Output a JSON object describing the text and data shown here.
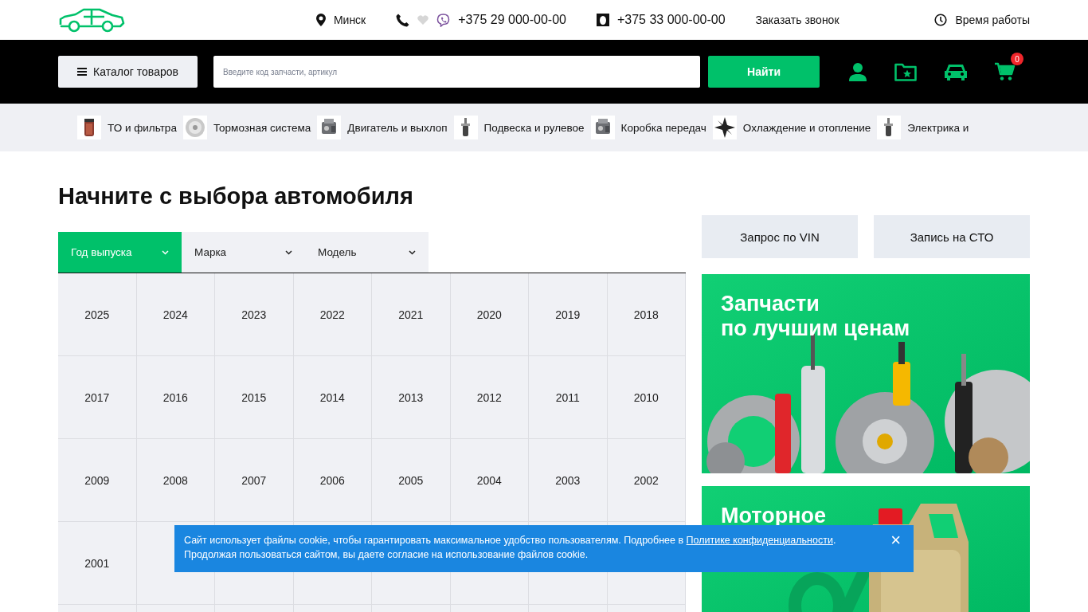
{
  "header": {
    "city": "Минск",
    "phones": [
      {
        "kind": "mobile",
        "number": "+375 29 000-00-00"
      },
      {
        "kind": "life",
        "number": "+375 33 000-00-00"
      }
    ],
    "callback": "Заказать звонок",
    "hours": "Время работы"
  },
  "navbar": {
    "catalog_button": "Каталог товаров",
    "search": {
      "placeholder": "Введите код запчасти, артикул"
    },
    "search_button": "Найти",
    "cart_count": "0"
  },
  "categories": [
    {
      "label": "ТО и фильтра",
      "kind": "filter"
    },
    {
      "label": "Тормозная система",
      "kind": "disc"
    },
    {
      "label": "Двигатель и выхлоп",
      "kind": "engine"
    },
    {
      "label": "Подвеска и рулевое",
      "kind": "shock"
    },
    {
      "label": "Коробка передач",
      "kind": "engine"
    },
    {
      "label": "Охлаждение и отопление",
      "kind": "fan"
    },
    {
      "label": "Электрика и",
      "kind": "shock"
    }
  ],
  "heading": "Начните с выбора автомобиля",
  "selector_tabs": [
    {
      "label": "Год выпуска",
      "selected": true
    },
    {
      "label": "Марка",
      "selected": false
    },
    {
      "label": "Модель",
      "selected": false
    }
  ],
  "years": [
    "2025",
    "2024",
    "2023",
    "2022",
    "2021",
    "2020",
    "2019",
    "2018",
    "2017",
    "2016",
    "2015",
    "2014",
    "2013",
    "2012",
    "2011",
    "2010",
    "2009",
    "2008",
    "2007",
    "2006",
    "2005",
    "2004",
    "2003",
    "2002",
    "2001"
  ],
  "side_buttons": [
    "Запрос по VIN",
    "Запись на СТО"
  ],
  "banners": [
    {
      "kind": "parts",
      "title_lines": [
        "Запчасти",
        "по лучшим ценам"
      ]
    },
    {
      "kind": "oil",
      "title_lines": [
        "Моторное"
      ]
    }
  ],
  "cookie": {
    "text_before": "Сайт использует файлы cookie, чтобы гарантировать максимальное удобство пользователям. Подробнее в ",
    "link": "Политике конфиденциальности",
    "text_after": ". Продолжая пользоваться сайтом, вы даете согласие на использование файлов cookie.",
    "close": "×"
  }
}
